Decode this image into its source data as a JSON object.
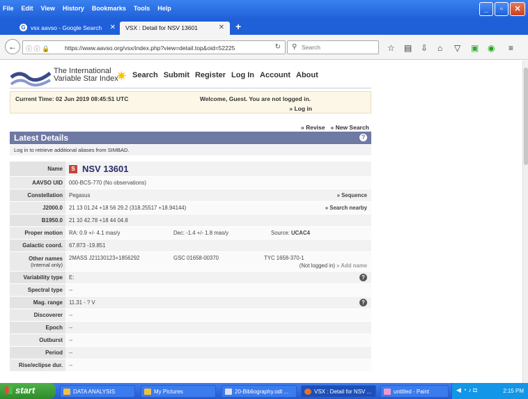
{
  "browser": {
    "menu": [
      "File",
      "Edit",
      "View",
      "History",
      "Bookmarks",
      "Tools",
      "Help"
    ],
    "tabs": [
      {
        "label": "vsx aavso - Google Search"
      },
      {
        "label": "VSX : Detail for NSV 13601"
      }
    ],
    "url": "https://www.aavso.org/vsx/index.php?view=detail.top&oid=52225",
    "search_placeholder": "Search"
  },
  "site": {
    "logo_line1": "The International",
    "logo_line2": "Variable Star Index",
    "nav": [
      "Search",
      "Submit",
      "Register",
      "Log In",
      "Account",
      "About"
    ],
    "current_time": "Current Time: 02 Jun 2019 08:45:51 UTC",
    "welcome": "Welcome, Guest. You are not logged in.",
    "login_link": "» Log in",
    "revise": "» Revise",
    "new_search": "» New Search",
    "details_title": "Latest Details",
    "login_msg": "Log in to retrieve additional aliases from SIMBAD."
  },
  "details": {
    "name_label": "Name",
    "name_badge": "S",
    "name": "NSV 13601",
    "auid_label": "AAVSO UID",
    "auid": "000-BCS-770 (No observations)",
    "const_label": "Constellation",
    "const": "Pegasus",
    "const_link": "» Sequence",
    "j2000_label": "J2000.0",
    "j2000": "21 13 01.24 +18 56 29.2  (318.25517 +18.94144)",
    "j2000_link": "» Search nearby",
    "b1950_label": "B1950.0",
    "b1950": "21 10 42.78 +18 44 04.8",
    "pm_label": "Proper motion",
    "pm_ra": "RA: 0.9 +/- 4.1 mas/y",
    "pm_dec": "Dec: -1.4 +/- 1.8 mas/y",
    "pm_source_label": "Source:",
    "pm_source": "UCAC4",
    "gal_label": "Galactic coord.",
    "gal": "67.873 -19.851",
    "other_label": "Other names",
    "other_sub": "(Internal only)",
    "other1": "2MASS J21130123+1856292",
    "other2": "GSC 01658-00370",
    "other3": "TYC 1658-370-1",
    "other_note": "(Not logged in)",
    "other_link": "» Add name",
    "vartype_label": "Variability type",
    "vartype": "E:",
    "spec_label": "Spectral type",
    "spec": "--",
    "mag_label": "Mag. range",
    "mag": "11.31 - ? V",
    "disc_label": "Discoverer",
    "disc": "--",
    "epoch_label": "Epoch",
    "epoch": "--",
    "outburst_label": "Outburst",
    "outburst": "--",
    "period_label": "Period",
    "period": "--",
    "rise_label": "Rise/eclipse dur.",
    "rise": "--"
  },
  "taskbar": {
    "start": "start",
    "tasks": [
      "DATA ANALYSIS",
      "My Pictures",
      "20-Bibliography.odt ...",
      "VSX : Detail for NSV ...",
      "untitled - Paint"
    ],
    "clock": "2:15 PM"
  }
}
